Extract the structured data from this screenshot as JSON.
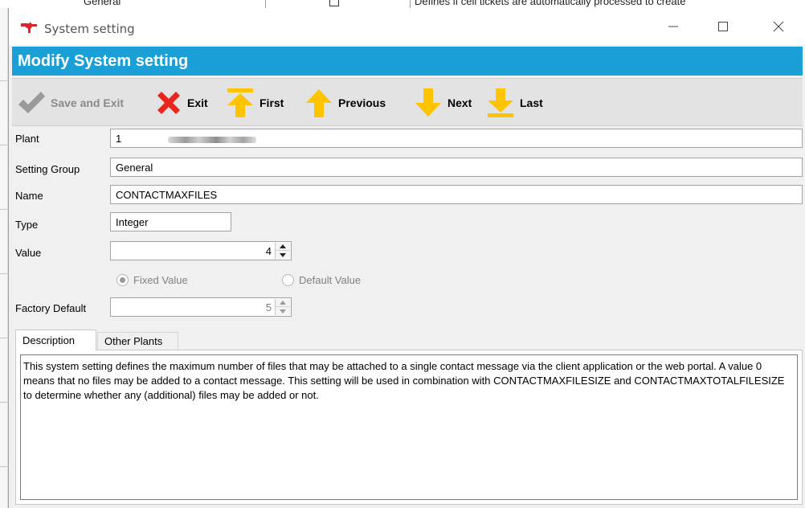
{
  "background": {
    "cell_1": "General",
    "cell_2": "Defines if cell tickets are automatically processed to create"
  },
  "window": {
    "title": "System setting",
    "minimize_icon": "minimize-icon",
    "maximize_icon": "maximize-icon",
    "close_icon": "close-icon"
  },
  "header": {
    "title": "Modify System setting",
    "color": "#1a9fd6"
  },
  "toolbar": {
    "save_exit_label": "Save and Exit",
    "exit_label": "Exit",
    "first_label": "First",
    "previous_label": "Previous",
    "next_label": "Next",
    "last_label": "Last",
    "arrow_color": "#ffc400",
    "exit_color": "#e8261d"
  },
  "form": {
    "plant_label": "Plant",
    "plant_value": "1",
    "setting_group_label": "Setting Group",
    "setting_group_value": "General",
    "name_label": "Name",
    "name_value": "CONTACTMAXFILES",
    "type_label": "Type",
    "type_value": "Integer",
    "value_label": "Value",
    "value_value": "4",
    "fixed_value_label": "Fixed Value",
    "default_value_label": "Default Value",
    "factory_default_label": "Factory Default",
    "factory_default_value": "5"
  },
  "tabs": {
    "description_label": "Description",
    "other_plants_label": "Other Plants"
  },
  "description": {
    "text": "This system setting defines the maximum number of files that may be attached to a single contact message via the client application or the web portal. A value 0 means that no files may be added to a contact message. This setting will be used in combination with CONTACTMAXFILESIZE and CONTACTMAXTOTALFILESIZE to determine whether any (additional) files may be added or not."
  }
}
